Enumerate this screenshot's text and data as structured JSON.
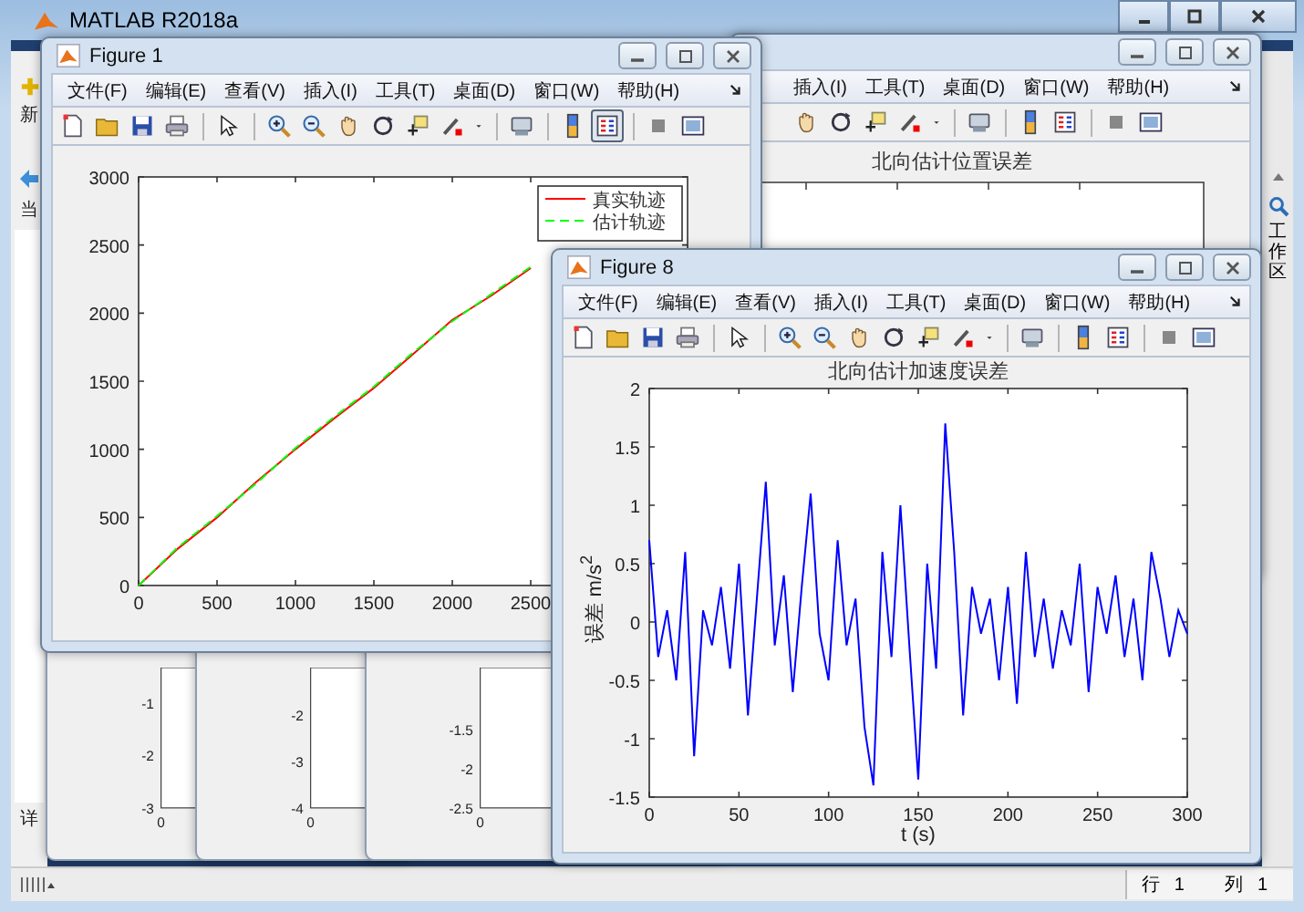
{
  "main_window": {
    "title": "MATLAB R2018a",
    "left_labels": [
      "新",
      "当",
      "详"
    ],
    "right_label": "工作区"
  },
  "background_figure": {
    "menu": [
      "插入(I)",
      "工具(T)",
      "桌面(D)",
      "窗口(W)",
      "帮助(H)"
    ],
    "legend_pressed": false,
    "plot_title": "北向估计位置误差"
  },
  "stacked_figures": [
    {
      "yticks": [
        "-1",
        "-2",
        "-3"
      ],
      "xtick": "0"
    },
    {
      "yticks": [
        "-2",
        "-3",
        "-4"
      ],
      "xtick": "0"
    },
    {
      "yticks": [
        "-1.5",
        "-2",
        "-2.5"
      ],
      "xtick": "0"
    }
  ],
  "figures": [
    {
      "title": "Figure 1",
      "menu": [
        "文件(F)",
        "编辑(E)",
        "查看(V)",
        "插入(I)",
        "工具(T)",
        "桌面(D)",
        "窗口(W)",
        "帮助(H)"
      ],
      "legend_pressed": true,
      "chart_data": {
        "type": "line",
        "x": [
          0,
          250,
          500,
          750,
          1000,
          1250,
          1500,
          1750,
          2000,
          2250,
          2500
        ],
        "xlim": [
          0,
          3500
        ],
        "ylim": [
          0,
          3000
        ],
        "xticks": [
          0,
          500,
          1000,
          1500,
          2000,
          2500
        ],
        "yticks": [
          0,
          500,
          1000,
          1500,
          2000,
          2500,
          3000
        ],
        "legend": "upper right",
        "series": [
          {
            "name": "真实轨迹",
            "color": "#ff0000",
            "line_style": "solid",
            "values": [
              0,
              270,
              500,
              760,
              1000,
              1230,
              1450,
              1700,
              1950,
              2130,
              2330
            ]
          },
          {
            "name": "估计轨迹",
            "color": "#00ff00",
            "line_style": "dashed",
            "values": [
              0,
              280,
              510,
              750,
              1010,
              1240,
              1460,
              1710,
              1940,
              2140,
              2340
            ]
          }
        ]
      }
    },
    {
      "title": "Figure 8",
      "menu": [
        "文件(F)",
        "编辑(E)",
        "查看(V)",
        "插入(I)",
        "工具(T)",
        "桌面(D)",
        "窗口(W)",
        "帮助(H)"
      ],
      "legend_pressed": false,
      "chart_data": {
        "type": "line",
        "title": "北向估计加速度误差",
        "xlabel": "t (s)",
        "ylabel": "误差 m/s$^{2}$",
        "x": [
          0,
          5,
          10,
          15,
          20,
          25,
          30,
          35,
          40,
          45,
          50,
          55,
          60,
          65,
          70,
          75,
          80,
          85,
          90,
          95,
          100,
          105,
          110,
          115,
          120,
          125,
          130,
          135,
          140,
          145,
          150,
          155,
          160,
          165,
          170,
          175,
          180,
          185,
          190,
          195,
          200,
          205,
          210,
          215,
          220,
          225,
          230,
          235,
          240,
          245,
          250,
          255,
          260,
          265,
          270,
          275,
          280,
          285,
          290,
          295,
          300
        ],
        "xlim": [
          0,
          300
        ],
        "ylim": [
          -1.5,
          2
        ],
        "xticks": [
          0,
          50,
          100,
          150,
          200,
          250,
          300
        ],
        "yticks": [
          -1.5,
          -1,
          -0.5,
          0,
          0.5,
          1,
          1.5,
          2
        ],
        "series": [
          {
            "color": "#0000ff",
            "line_style": "solid",
            "values": [
              0.7,
              -0.3,
              0.1,
              -0.5,
              0.6,
              -1.15,
              0.1,
              -0.2,
              0.3,
              -0.4,
              0.5,
              -0.8,
              0.2,
              1.2,
              -0.2,
              0.4,
              -0.6,
              0.3,
              1.1,
              -0.1,
              -0.5,
              0.7,
              -0.2,
              0.2,
              -0.9,
              -1.4,
              0.6,
              -0.3,
              1.0,
              -0.2,
              -1.35,
              0.5,
              -0.4,
              1.7,
              0.6,
              -0.8,
              0.3,
              -0.1,
              0.2,
              -0.5,
              0.3,
              -0.7,
              0.6,
              -0.3,
              0.2,
              -0.4,
              0.1,
              -0.2,
              0.5,
              -0.6,
              0.3,
              -0.1,
              0.4,
              -0.3,
              0.2,
              -0.5,
              0.6,
              0.2,
              -0.3,
              0.1,
              -0.1
            ]
          }
        ]
      }
    }
  ],
  "status_bar": {
    "row_label": "行",
    "row": "1",
    "col_label": "列",
    "col": "1"
  }
}
